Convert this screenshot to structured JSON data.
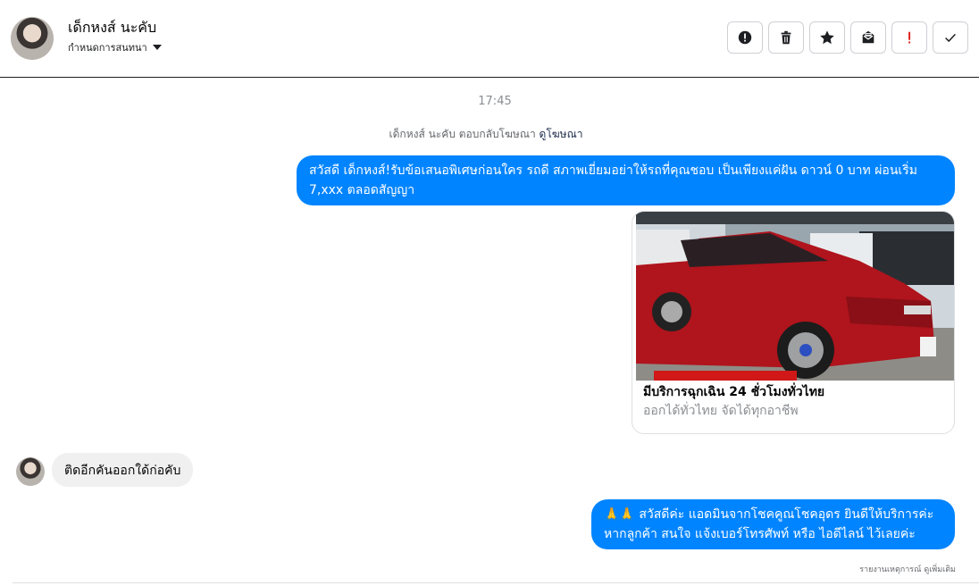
{
  "contact": {
    "name": "เด็กหงส์ นะคับ",
    "subtitle": "กำหนดการสนทนา"
  },
  "toolbar": [
    {
      "name": "report-icon"
    },
    {
      "name": "trash-icon"
    },
    {
      "name": "star-icon"
    },
    {
      "name": "mark-unread-icon"
    },
    {
      "name": "important-icon"
    },
    {
      "name": "done-check-icon"
    }
  ],
  "thread": {
    "timestamp": "17:45",
    "ad_reply_text": "เด็กหงส์ นะคับ ตอบกลับโฆษณา",
    "ad_link": "ดูโฆษณา",
    "msg1": "สวัสดี เด็กหงส์!รับข้อเสนอพิเศษก่อนใคร รถดี สภาพเยี่ยมอย่าให้รถที่คุณชอบ เป็นเพียงแค่ฝัน ดาวน์ 0 บาท ผ่อนเริ่ม 7,xxx ตลอดสัญญา",
    "card_title": "มีบริการฉุกเฉิน 24 ชั่วโมงทั่วไทย",
    "card_subtitle": "ออกได้ทั่วไทย จัดได้ทุกอาชีพ",
    "msg2": "ติดอีกคันออกใด้ก่อคับ",
    "msg3_emoji": "🙏🙏",
    "msg3": "สวัสดีค่ะ แอดมินจากโชคคูณโชคอุดร ยินดีให้บริการค่ะ หากลูกค้า สนใจ แจ้งเบอร์โทรศัพท์ หรือ ไอดีไลน์  ไว้เลยค่ะ",
    "footer_note": "รายงานเหตุการณ์ ดูเพิ่มเติม"
  },
  "colors": {
    "outgoing": "#0084ff",
    "incoming": "#f0f0f0",
    "important": "#e02020"
  }
}
